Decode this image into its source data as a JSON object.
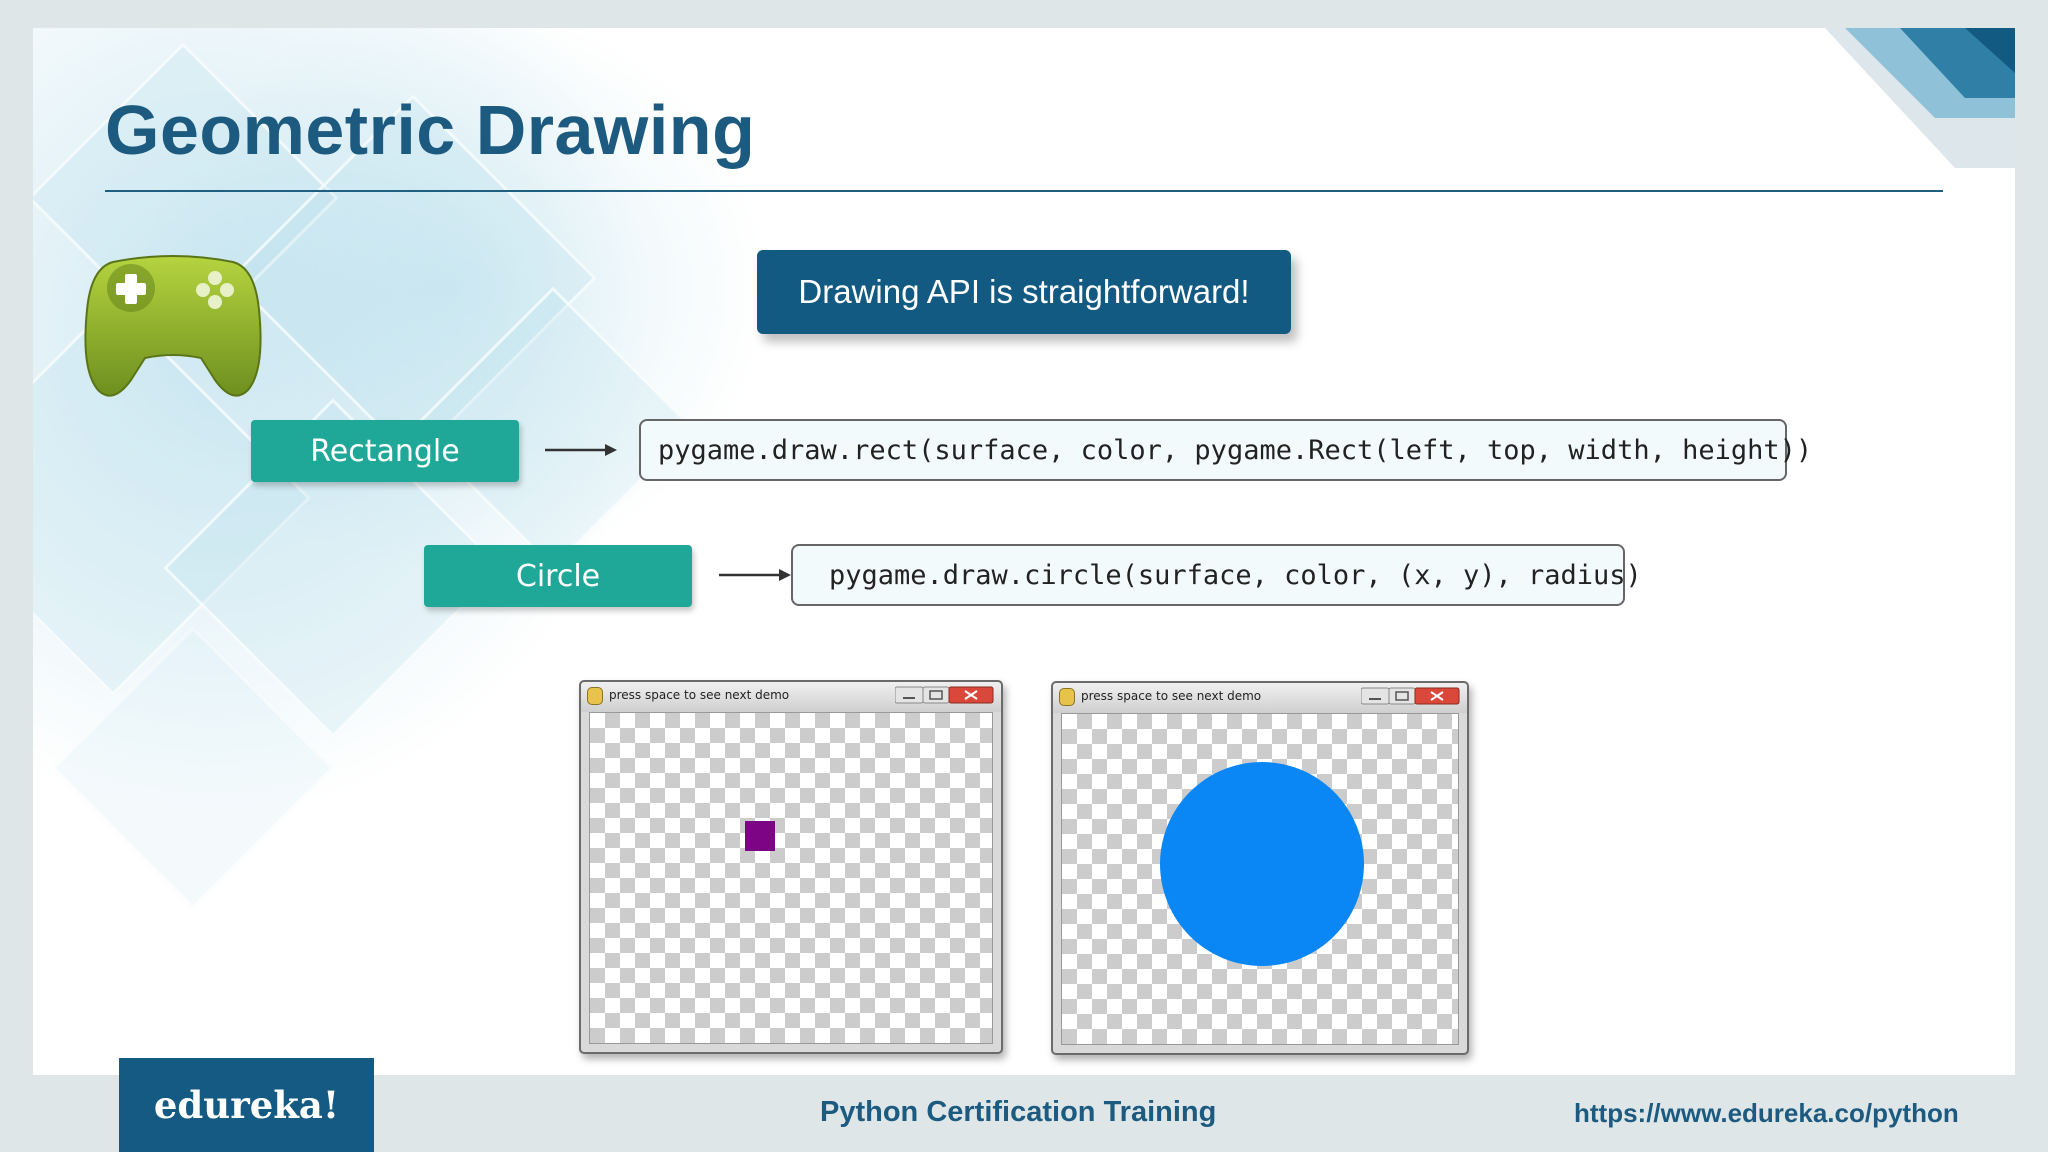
{
  "slide": {
    "title": "Geometric Drawing",
    "callout": "Drawing API is straightforward!"
  },
  "items": [
    {
      "label": "Rectangle",
      "code": "pygame.draw.rect(surface, color, pygame.Rect(left, top, width, height))"
    },
    {
      "label": "Circle",
      "code": "pygame.draw.circle(surface, color, (x, y), radius)"
    }
  ],
  "demo_windows": [
    {
      "title": "press space to see next demo",
      "shape": "rectangle",
      "shape_color": "#7d0585"
    },
    {
      "title": "press space to see next demo",
      "shape": "circle",
      "shape_color": "#0a87f5"
    }
  ],
  "icons": {
    "gamepad": "gamepad-icon",
    "window_logo": "pygame-logo-icon"
  },
  "footer": {
    "brand": "edureka!",
    "course": "Python Certification Training",
    "url": "https://www.edureka.co/python"
  },
  "colors": {
    "primary": "#155a82",
    "accent_teal": "#1fa898",
    "gamepad_green": "#8ab32e"
  }
}
